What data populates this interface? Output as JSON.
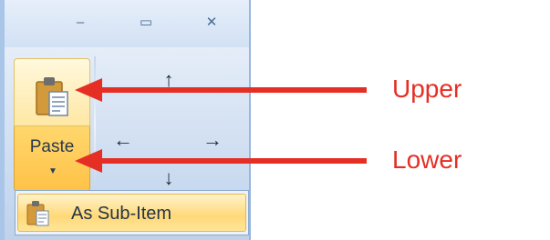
{
  "window": {
    "minimize_icon": "minimize-icon",
    "maximize_icon": "maximize-icon",
    "close_icon": "close-icon",
    "minimize_glyph": "–",
    "maximize_glyph": "▭",
    "close_glyph": "✕"
  },
  "paste": {
    "label": "Paste",
    "caret": "▼",
    "icon": "clipboard-icon"
  },
  "move_pad": {
    "up": "↑",
    "left": "←",
    "right": "→",
    "down": "↓"
  },
  "dropdown": {
    "items": [
      {
        "label": "As Sub-Item",
        "icon": "clipboard-icon"
      }
    ]
  },
  "callouts": {
    "upper": "Upper",
    "lower": "Lower"
  },
  "colors": {
    "arrow": "#e52e24",
    "hover_gold": "#ffc247",
    "ribbon_blue": "#c9daf0"
  }
}
